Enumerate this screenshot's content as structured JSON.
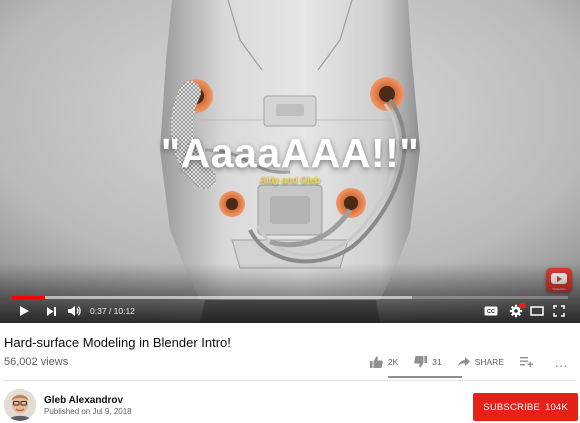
{
  "video": {
    "overlay_title": "\"AaaaAAA!!\"",
    "overlay_subtitle": "Aidy and Gleb",
    "watermark_label": "Subscribe",
    "progress_fraction": 0.06,
    "buffer_fraction": 0.72,
    "time_current": "0:37",
    "time_separator": " / ",
    "time_total": "10:12"
  },
  "player_icons": {
    "play": "play-icon",
    "next": "next-icon",
    "volume": "volume-icon",
    "captions": "cc-icon",
    "settings": "settings-icon",
    "theater": "theater-mode-icon",
    "fullscreen": "fullscreen-icon"
  },
  "info": {
    "title": "Hard-surface Modeling in Blender Intro!",
    "views": "56,002 views",
    "likes": "2K",
    "dislikes": "31",
    "share": "SHARE",
    "more": "…"
  },
  "channel": {
    "name": "Gleb Alexandrov",
    "published": "Published on Jul 9, 2018",
    "subscribe_label": "SUBSCRIBE",
    "subscriber_count": "104K"
  },
  "colors": {
    "accent_red": "#e62117",
    "progress_red": "#ff0000",
    "overlay_yellow": "#f4d34a"
  }
}
